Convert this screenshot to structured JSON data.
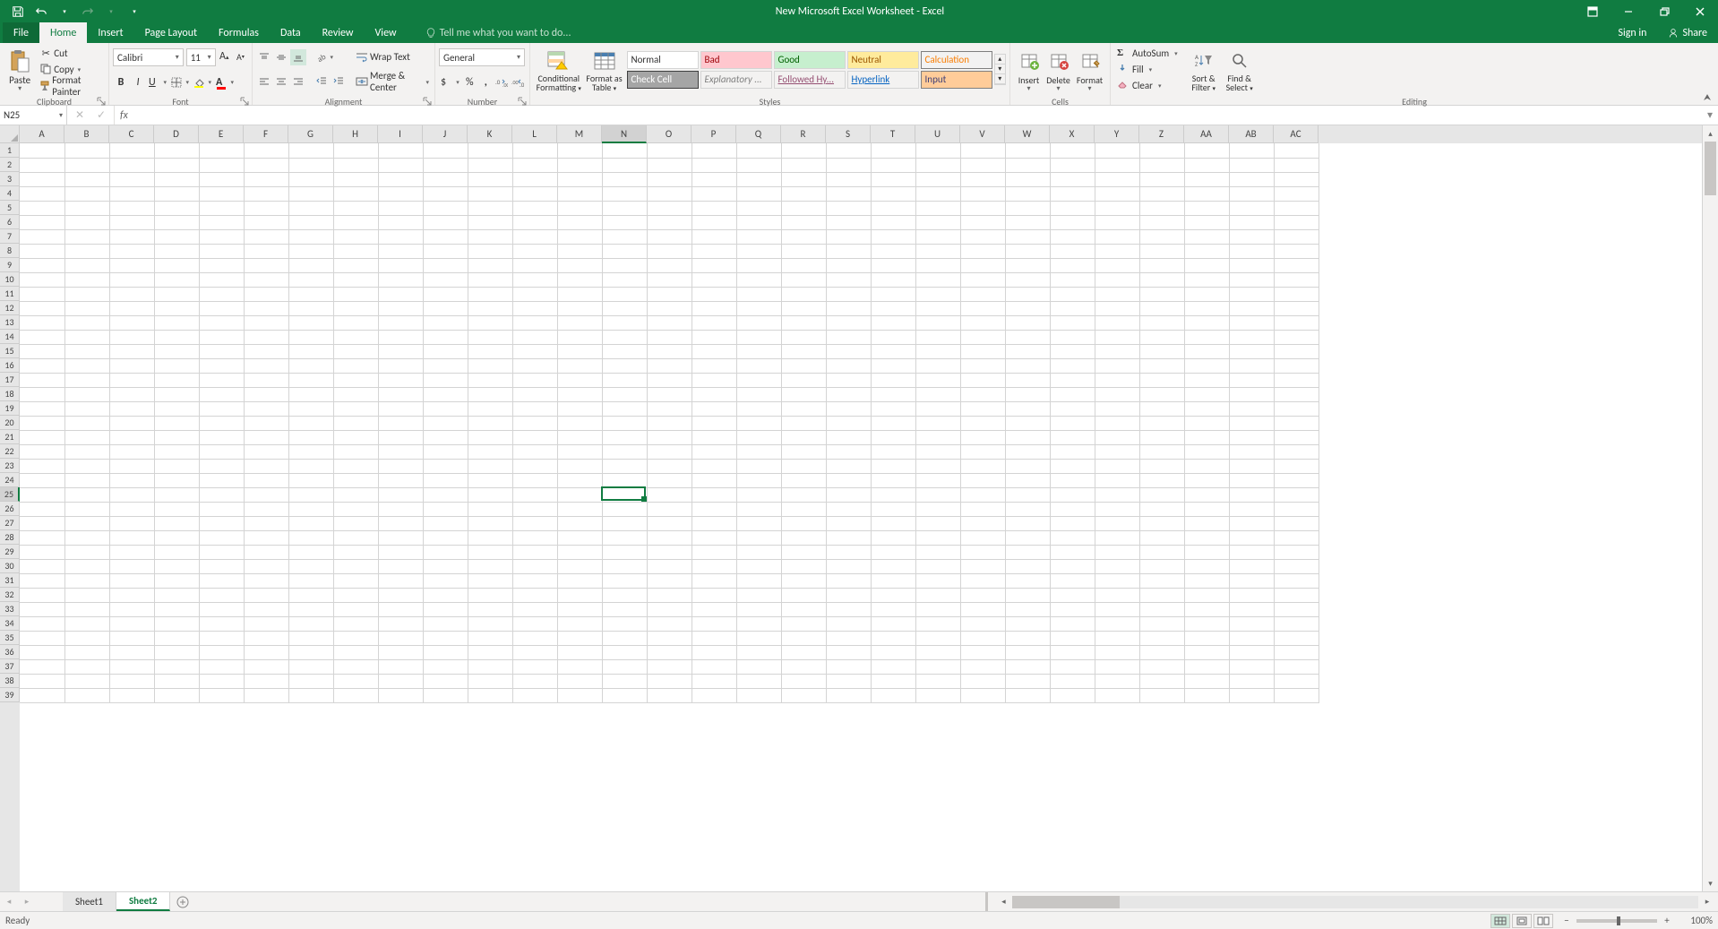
{
  "title": "New Microsoft Excel Worksheet - Excel",
  "qat": {
    "save": "Save",
    "undo": "Undo",
    "redo": "Redo"
  },
  "window": {
    "signin": "Sign in",
    "share": "Share"
  },
  "tabs": {
    "file": "File",
    "home": "Home",
    "insert": "Insert",
    "pagelayout": "Page Layout",
    "formulas": "Formulas",
    "data": "Data",
    "review": "Review",
    "view": "View",
    "tellme": "Tell me what you want to do..."
  },
  "ribbon": {
    "clipboard": {
      "label": "Clipboard",
      "paste": "Paste",
      "cut": "Cut",
      "copy": "Copy",
      "formatpainter": "Format Painter"
    },
    "font": {
      "label": "Font",
      "name": "Calibri",
      "size": "11"
    },
    "alignment": {
      "label": "Alignment",
      "wrap": "Wrap Text",
      "merge": "Merge & Center"
    },
    "number": {
      "label": "Number",
      "format": "General"
    },
    "styles": {
      "label": "Styles",
      "condfmt": "Conditional Formatting",
      "condfmt2": "",
      "fmtastable": "Format as Table",
      "fmtastable2": "",
      "normal": "Normal",
      "bad": "Bad",
      "good": "Good",
      "neutral": "Neutral",
      "calculation": "Calculation",
      "checkcell": "Check Cell",
      "explanatory": "Explanatory ...",
      "followed": "Followed Hy...",
      "hyperlink": "Hyperlink",
      "input": "Input"
    },
    "cells": {
      "label": "Cells",
      "insert": "Insert",
      "delete": "Delete",
      "format": "Format"
    },
    "editing": {
      "label": "Editing",
      "autosum": "AutoSum",
      "fill": "Fill",
      "clear": "Clear",
      "sortfilter": "Sort & Filter",
      "findselect": "Find & Select"
    }
  },
  "namebox": "N25",
  "formula": "",
  "columns": [
    "A",
    "B",
    "C",
    "D",
    "E",
    "F",
    "G",
    "H",
    "I",
    "J",
    "K",
    "L",
    "M",
    "N",
    "O",
    "P",
    "Q",
    "R",
    "S",
    "T",
    "U",
    "V",
    "W",
    "X",
    "Y",
    "Z",
    "AA",
    "AB",
    "AC"
  ],
  "selectedCol": "N",
  "rowCount": 39,
  "selectedRow": 25,
  "sheets": {
    "sheet1": "Sheet1",
    "sheet2": "Sheet2"
  },
  "status": {
    "ready": "Ready",
    "zoom": "100%"
  }
}
